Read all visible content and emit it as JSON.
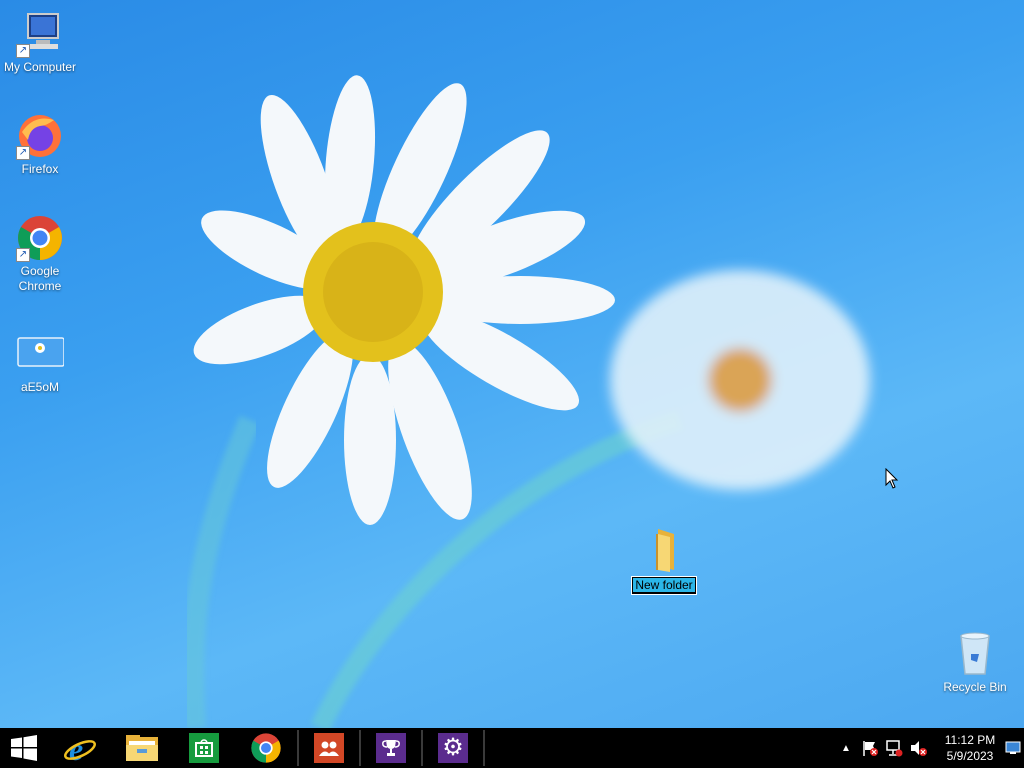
{
  "desktop": {
    "icons": [
      {
        "label": "My Computer",
        "icon": "computer-icon"
      },
      {
        "label": "Firefox",
        "icon": "firefox-icon"
      },
      {
        "label": "Google Chrome",
        "icon": "chrome-icon"
      },
      {
        "label": "aE5oM",
        "icon": "image-file-icon"
      },
      {
        "label": "New folder",
        "icon": "folder-icon",
        "state": "renaming"
      },
      {
        "label": "Recycle Bin",
        "icon": "recycle-bin-icon"
      }
    ]
  },
  "taskbar": {
    "pinned": [
      {
        "name": "start-button",
        "icon": "windows-logo-icon"
      },
      {
        "name": "internet-explorer",
        "icon": "ie-icon"
      },
      {
        "name": "file-explorer",
        "icon": "folder-icon"
      },
      {
        "name": "store",
        "icon": "store-icon"
      },
      {
        "name": "google-chrome",
        "icon": "chrome-icon"
      },
      {
        "name": "people",
        "icon": "people-icon"
      },
      {
        "name": "games",
        "icon": "trophy-icon"
      },
      {
        "name": "settings",
        "icon": "gear-icon"
      }
    ],
    "tray": {
      "time": "11:12 PM",
      "date": "5/9/2023"
    }
  },
  "colors": {
    "desktop_bg": "#3a9ff0",
    "taskbar_bg": "#000000",
    "rename_highlight": "#2bb6e8",
    "store_green": "#169b3e",
    "people_orange": "#d24726",
    "purple_tile": "#5b2c8e"
  }
}
